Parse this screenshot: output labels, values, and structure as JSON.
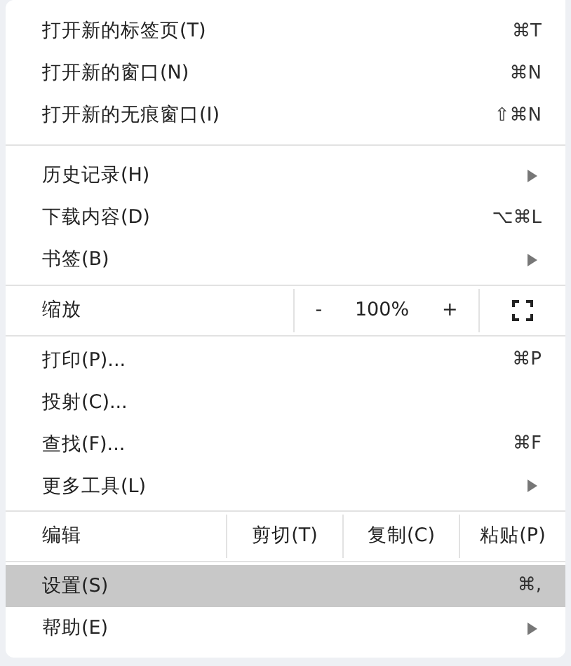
{
  "menu": {
    "groups": [
      [
        {
          "kind": "item",
          "label": "打开新的标签页(T)",
          "shortcut": "⌘T",
          "submenu": false,
          "selected": false
        },
        {
          "kind": "item",
          "label": "打开新的窗口(N)",
          "shortcut": "⌘N",
          "submenu": false,
          "selected": false
        },
        {
          "kind": "item",
          "label": "打开新的无痕窗口(I)",
          "shortcut": "⇧⌘N",
          "submenu": false,
          "selected": false
        }
      ],
      [
        {
          "kind": "item",
          "label": "历史记录(H)",
          "submenu": true,
          "selected": false
        },
        {
          "kind": "item",
          "label": "下载内容(D)",
          "shortcut": "⌥⌘L",
          "submenu": false,
          "selected": false
        },
        {
          "kind": "item",
          "label": "书签(B)",
          "submenu": true,
          "selected": false
        }
      ],
      [
        {
          "kind": "zoom",
          "label": "缩放",
          "minus": "-",
          "value": "100%",
          "plus": "+"
        }
      ],
      [
        {
          "kind": "item",
          "label": "打印(P)...",
          "shortcut": "⌘P",
          "submenu": false,
          "selected": false
        },
        {
          "kind": "item",
          "label": "投射(C)...",
          "submenu": false,
          "selected": false
        },
        {
          "kind": "item",
          "label": "查找(F)...",
          "shortcut": "⌘F",
          "submenu": false,
          "selected": false
        },
        {
          "kind": "item",
          "label": "更多工具(L)",
          "submenu": true,
          "selected": false
        }
      ],
      [
        {
          "kind": "edit",
          "label": "编辑",
          "buttons": [
            "剪切(T)",
            "复制(C)",
            "粘贴(P)"
          ]
        }
      ],
      [
        {
          "kind": "item",
          "label": "设置(S)",
          "shortcut": "⌘,",
          "submenu": false,
          "selected": true
        },
        {
          "kind": "item",
          "label": "帮助(E)",
          "submenu": true,
          "selected": false
        }
      ]
    ]
  }
}
